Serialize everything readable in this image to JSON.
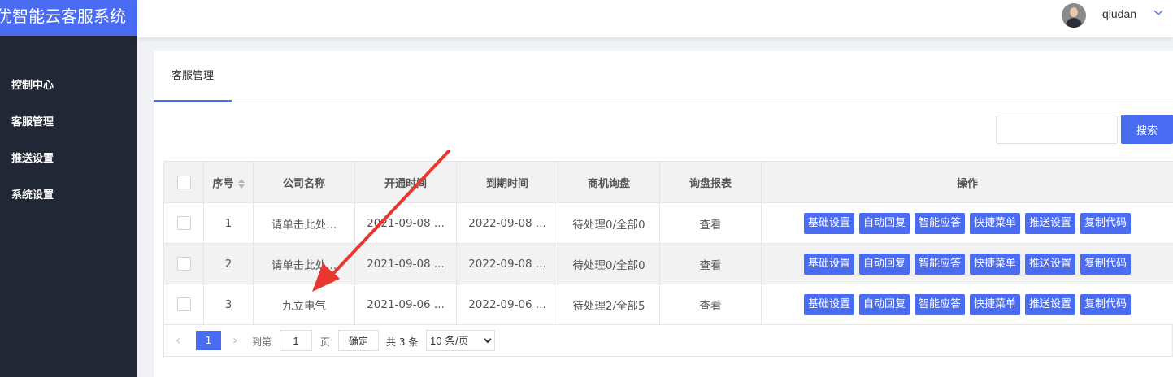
{
  "app": {
    "title": "优智能云客服系统"
  },
  "sidebar": {
    "items": [
      {
        "label": "控制中心"
      },
      {
        "label": "客服管理"
      },
      {
        "label": "推送设置"
      },
      {
        "label": "系统设置"
      }
    ]
  },
  "header": {
    "username": "qiudan"
  },
  "tabs": [
    {
      "label": "客服管理"
    }
  ],
  "search": {
    "button_label": "搜索",
    "value": ""
  },
  "table": {
    "columns": [
      "序号",
      "公司名称",
      "开通时间",
      "到期时间",
      "商机询盘",
      "询盘报表",
      "操作"
    ],
    "rows": [
      {
        "index": "1",
        "company": "请单击此处...",
        "open_date": "2021-09-08 ...",
        "expire_date": "2022-09-08 ...",
        "inquiries": "待处理0/全部0",
        "report": "查看"
      },
      {
        "index": "2",
        "company": "请单击此处...",
        "open_date": "2021-09-08 ...",
        "expire_date": "2022-09-08 ...",
        "inquiries": "待处理0/全部0",
        "report": "查看"
      },
      {
        "index": "3",
        "company": "九立电气",
        "open_date": "2021-09-06 ...",
        "expire_date": "2022-09-06 ...",
        "inquiries": "待处理2/全部5",
        "report": "查看"
      }
    ],
    "actions": [
      "基础设置",
      "自动回复",
      "智能应答",
      "快捷菜单",
      "推送设置",
      "复制代码"
    ]
  },
  "pagination": {
    "current_page": "1",
    "goto_label": "到第",
    "goto_value": "1",
    "page_unit": "页",
    "confirm_label": "确定",
    "total_text": "共 3 条",
    "page_size_options": [
      "10 条/页"
    ]
  },
  "colors": {
    "accent": "#4a6cf2",
    "sidebar": "#222735",
    "annotation_arrow": "#e8372f"
  }
}
